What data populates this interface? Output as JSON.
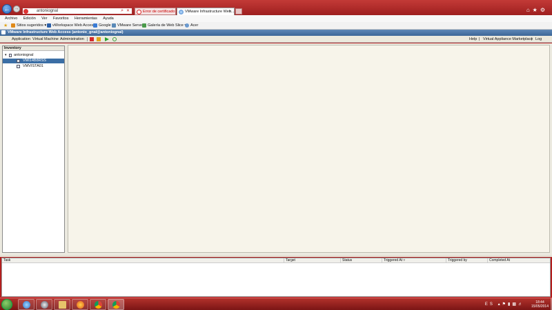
{
  "browser": {
    "address_url": "antoniognal",
    "tabs": [
      {
        "label": "Error de certificado"
      },
      {
        "label": "VMware Infrastructure Web..."
      }
    ],
    "menu": [
      "Archivo",
      "Edición",
      "Ver",
      "Favoritos",
      "Herramientas",
      "Ayuda"
    ],
    "favorites": [
      {
        "label": "Sitios sugeridos ▾"
      },
      {
        "label": "vWorkspace Web Access"
      },
      {
        "label": "Google"
      },
      {
        "label": "VMware Server"
      },
      {
        "label": "Galería de Web Slice ▾"
      },
      {
        "label": "Acer"
      }
    ]
  },
  "app": {
    "header_title": "VMware Infrastructure Web Access (antonio_gnal@antoniognal)",
    "menu": [
      "Application",
      "Virtual Machine",
      "Administration"
    ],
    "right_links": [
      "Help",
      "|",
      "Virtual Appliance Marketplace",
      "|",
      "Log"
    ],
    "inventory": {
      "title": "Inventory",
      "host": "antoniognal",
      "vms": [
        {
          "label": "VMI14B8RSS",
          "selected": true
        },
        {
          "label": "VMVISTA01",
          "selected": false
        }
      ]
    },
    "tasks_columns": [
      "Task",
      "Target",
      "Status",
      "Triggered At ▿",
      "Triggered by",
      "Completed At"
    ]
  },
  "taskbar": {
    "lang": "ES",
    "time": "18:44",
    "date": "15/05/2014"
  },
  "colors": {
    "chrome_red": "#b31e1e",
    "vmware_blue": "#3c6698",
    "selection": "#3b6ea5"
  }
}
